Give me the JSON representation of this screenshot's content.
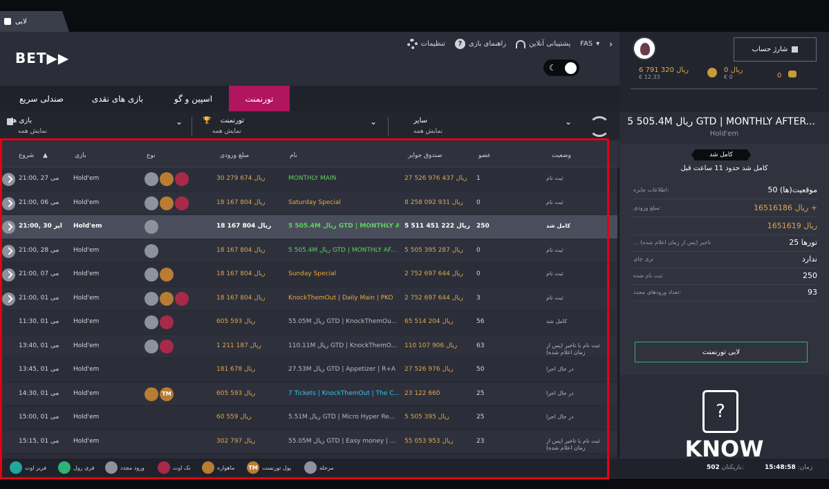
{
  "app": {
    "lobby_tab": "لابی",
    "logo": "BET▶▶"
  },
  "header": {
    "settings": "تنظیمات",
    "help": "راهنمای بازی",
    "support": "پشتیبانی آنلاین",
    "lang": "FAS"
  },
  "account": {
    "charge": "شارژ حساب",
    "bal1": {
      "value": "6 791 320 ریال",
      "sub": "€ 12.33"
    },
    "bal2": {
      "value": "0 ریال",
      "sub": "€ 0"
    },
    "bal3": {
      "value": "0"
    }
  },
  "tabs": [
    {
      "label": "تورنمنت",
      "active": true
    },
    {
      "label": "اسپین و گو"
    },
    {
      "label": "بازی های نقدی"
    },
    {
      "label": "صندلی سریع"
    }
  ],
  "filters": [
    {
      "title": "سایر",
      "sub": "نمایش همه"
    },
    {
      "title": "تورنمنت",
      "sub": "نمایش همه"
    },
    {
      "title": "بازی ها",
      "sub": "نمایش همه"
    }
  ],
  "table": {
    "headers": {
      "start": "شروع",
      "game": "بازی",
      "type": "نوع",
      "entry": "مبلغ ورودی",
      "name": "نام",
      "prize": "صندوق جوایز",
      "players": "عضو",
      "status": "وضعیت"
    },
    "rows": [
      {
        "start": "می 27 ,21:00",
        "game": "Hold'em",
        "icons": [
          "rebuy",
          "bounty",
          "knockout"
        ],
        "entry": "30 279 674 ریال",
        "name": "MONTHLY MAIN",
        "prize": "27 526 976 437 ریال",
        "players": "1",
        "status": "ثبت نام",
        "pin": true,
        "color": "green"
      },
      {
        "start": "می 06 ,21:00",
        "game": "Hold'em",
        "icons": [
          "rebuy",
          "bounty",
          "knockout"
        ],
        "entry": "18 167 804 ریال",
        "name": "Saturday Special",
        "prize": "8 258 092 931 ریال",
        "players": "0",
        "status": "ثبت نام",
        "pin": true,
        "color": "yellow"
      },
      {
        "start": "آپر 30 ,21:00",
        "game": "Hold'em",
        "icons": [
          "rebuy"
        ],
        "entry": "18 167 804 ریال",
        "name": "5 505.4M ریال GTD | MONTHLY AF...",
        "prize": "5 511 451 222 ریال",
        "players": "250",
        "status": "کامل شد",
        "pin": true,
        "color": "green",
        "hl": true
      },
      {
        "start": "می 28 ,21:00",
        "game": "Hold'em",
        "icons": [
          "rebuy"
        ],
        "entry": "18 167 804 ریال",
        "name": "5 505.4M ریال GTD | MONTHLY AF...",
        "prize": "5 505 395 287 ریال",
        "players": "0",
        "status": "ثبت نام",
        "pin": true,
        "color": "green"
      },
      {
        "start": "می 07 ,21:00",
        "game": "Hold'em",
        "icons": [
          "rebuy",
          "bounty"
        ],
        "entry": "18 167 804 ریال",
        "name": "Sunday Special",
        "prize": "2 752 697 644 ریال",
        "players": "0",
        "status": "ثبت نام",
        "pin": true,
        "color": "yellow"
      },
      {
        "start": "می 01 ,21:00",
        "game": "Hold'em",
        "icons": [
          "rebuy",
          "bounty",
          "knockout"
        ],
        "entry": "18 167 804 ریال",
        "name": "KnockThemOut | Daily Main | PKO",
        "prize": "2 752 697 644 ریال",
        "players": "3",
        "status": "ثبت نام",
        "pin": true,
        "color": "yellow"
      },
      {
        "start": "می 01 ,11:30",
        "game": "Hold'em",
        "icons": [
          "rebuy",
          "knockout"
        ],
        "entry": "605 593 ریال",
        "name": "55.05M ریال GTD | KnockThemOu...",
        "prize": "65 514 204 ریال",
        "players": "56",
        "status": "کامل شد",
        "pin": false,
        "color": ""
      },
      {
        "start": "می 01 ,13:40",
        "game": "Hold'em",
        "icons": [
          "rebuy",
          "knockout"
        ],
        "entry": "1 211 187 ریال",
        "name": "110.11M ریال GTD | KnockThemO...",
        "prize": "110 107 906 ریال",
        "players": "63",
        "status": "ثبت نام با تاخیر (پس از زمان اعلام شده)",
        "pin": false,
        "color": ""
      },
      {
        "start": "می 01 ,13:45",
        "game": "Hold'em",
        "icons": [],
        "entry": "181 678 ریال",
        "name": "27.53M ریال GTD | Appetizer | R+A",
        "prize": "27 526 976 ریال",
        "players": "50",
        "status": "در حال اجرا",
        "pin": false,
        "color": ""
      },
      {
        "start": "می 01 ,14:30",
        "game": "Hold'em",
        "icons": [
          "bounty",
          "ticket"
        ],
        "entry": "605 593 ریال",
        "name": "7 Tickets | KnockThemOut | The C...",
        "prize": "23 122 660",
        "players": "25",
        "status": "در حال اجرا",
        "pin": false,
        "color": "blue"
      },
      {
        "start": "می 01 ,15:00",
        "game": "Hold'em",
        "icons": [],
        "entry": "60 559 ریال",
        "name": "5.51M ریال GTD | Micro Hyper Re...",
        "prize": "5 505 395 ریال",
        "players": "25",
        "status": "در حال اجرا",
        "pin": false,
        "color": ""
      },
      {
        "start": "می 01 ,15:15",
        "game": "Hold'em",
        "icons": [],
        "entry": "302 797 ریال",
        "name": "55.05M ریال GTD | Easy money | ...",
        "prize": "55 053 953 ریال",
        "players": "23",
        "status": "ثبت نام با تاخیر (پس از زمان اعلام شده)",
        "pin": false,
        "color": ""
      }
    ]
  },
  "legend": [
    {
      "icon": "stage",
      "label": "مرحله"
    },
    {
      "icon": "ticket",
      "label": "پول تورنمنت",
      "text": "TM"
    },
    {
      "icon": "bounty",
      "label": "ماهواره"
    },
    {
      "icon": "knockout",
      "label": "نک اوت"
    },
    {
      "icon": "rebuy",
      "label": "ورود مجدد"
    },
    {
      "icon": "freeroll",
      "label": "فری رول"
    },
    {
      "icon": "freezeout",
      "label": "فریز اوت"
    }
  ],
  "detail": {
    "title": "5 505.4M ریال GTD | MONTHLY AFTER...",
    "subtitle": "Hold'em",
    "badge": "کامل شد",
    "badge_sub": "کامل شد حدود 11 ساعت قبل",
    "rows": [
      {
        "k": "موقعیت(ها) 50",
        "v": ""
      },
      {
        "k": "مبلغ ورودی:",
        "v": "16516186 ریال +"
      },
      {
        "k": "",
        "v": "1651619 ریال"
      },
      {
        "k": "... تاخیر (پس از زمان اعلام شده)",
        "v": "تورها 25"
      },
      {
        "k": "تری چای",
        "v": "ندارد"
      },
      {
        "k": "ثبت نام شده",
        "v": "250"
      },
      {
        "k": "تعداد ورودهای مجدد:",
        "v": "93"
      }
    ],
    "row0_key2": "اطلاعات جایزه:",
    "lobby_button": "لابی تورنمنت"
  },
  "promo": {
    "text": "KNOW"
  },
  "statusbar": {
    "players_label": "بازیکنان:",
    "players": "502",
    "time_label": "زمان:",
    "time": "15:48:58"
  }
}
